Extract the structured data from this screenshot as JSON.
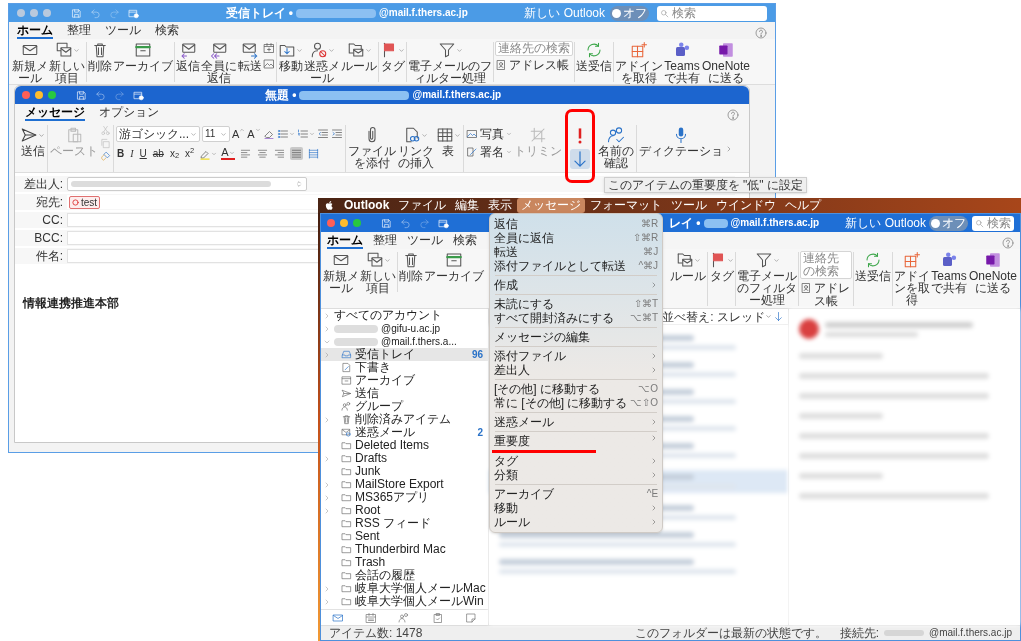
{
  "back_window": {
    "active": false,
    "title": {
      "prefix": "受信トレイ •",
      "suffix": "@mail.f.thers.ac.jp"
    },
    "new_outlook": {
      "label": "新しい Outlook",
      "toggle_text": "オフ",
      "on": false
    },
    "search": {
      "placeholder": "検索"
    },
    "tabs": [
      {
        "label": "ホーム",
        "selected": true
      },
      {
        "label": "整理",
        "selected": false
      },
      {
        "label": "ツール",
        "selected": false
      },
      {
        "label": "検索",
        "selected": false
      }
    ],
    "ribbon": [
      {
        "kind": "button",
        "label": "新規メール"
      },
      {
        "kind": "button",
        "label": "新しい項目",
        "dropdown": true
      },
      {
        "kind": "divider"
      },
      {
        "kind": "button",
        "label": "削除"
      },
      {
        "kind": "button",
        "label": "アーカイブ"
      },
      {
        "kind": "divider"
      },
      {
        "kind": "button",
        "label": "返信"
      },
      {
        "kind": "button",
        "label": "全員に返信"
      },
      {
        "kind": "button",
        "label": "転送"
      },
      {
        "kind": "stack"
      },
      {
        "kind": "divider"
      },
      {
        "kind": "button",
        "label": "移動",
        "dropdown": true
      },
      {
        "kind": "button",
        "label": "迷惑メール",
        "dropdown": true
      },
      {
        "kind": "button",
        "label": "ルール",
        "dropdown": true
      },
      {
        "kind": "divider"
      },
      {
        "kind": "button",
        "label": "タグ",
        "dropdown": true
      },
      {
        "kind": "divider"
      },
      {
        "kind": "button",
        "label": "電子メールのフィルター処理",
        "dropdown": true
      },
      {
        "kind": "divider"
      },
      {
        "kind": "search",
        "placeholder": "連絡先の検索",
        "label": "アドレス帳"
      },
      {
        "kind": "divider"
      },
      {
        "kind": "button",
        "label": "送受信"
      },
      {
        "kind": "divider"
      },
      {
        "kind": "button",
        "label": "アドインを取得"
      },
      {
        "kind": "button",
        "label": "Teamsで共有"
      },
      {
        "kind": "button",
        "label": "OneNoteに送る"
      }
    ]
  },
  "compose_window": {
    "active": true,
    "title": {
      "prefix": "無題 •",
      "suffix": "@mail.f.thers.ac.jp"
    },
    "tabs": [
      {
        "label": "メッセージ",
        "selected": true
      },
      {
        "label": "オプション",
        "selected": false
      }
    ],
    "send": {
      "label": "送信"
    },
    "paste": {
      "label": "ペースト",
      "disabled": true
    },
    "font": {
      "name": "游ゴシック...",
      "size": "11"
    },
    "grow_shrink": [
      {
        "kind": "grow",
        "label": "A"
      },
      {
        "kind": "shrink",
        "label": "A"
      }
    ],
    "format_buttons": [
      {
        "label": "B"
      },
      {
        "label": "I"
      },
      {
        "label": "U"
      },
      {
        "label": "ab"
      },
      {
        "label": "x$_{2}$"
      },
      {
        "label": "x$^{2}$"
      }
    ],
    "font_color": {
      "label": "A"
    },
    "align_buttons": [
      {
        "kind": "left",
        "selected": false
      },
      {
        "kind": "center",
        "selected": false
      },
      {
        "kind": "right",
        "selected": false
      },
      {
        "kind": "justify",
        "selected": true
      },
      {
        "kind": "distributed",
        "selected": false
      }
    ],
    "insert_buttons": [
      {
        "label": "ファイルを添付"
      },
      {
        "label": "リンクの挿入",
        "dropdown": true
      },
      {
        "label": "表",
        "dropdown": true
      }
    ],
    "small_buttons": [
      {
        "label": "写真"
      },
      {
        "label": "署名"
      }
    ],
    "crop": {
      "label": "トリミン",
      "disabled": true
    },
    "importance": {
      "annotated": true,
      "buttons": [
        {
          "kind": "high",
          "hovered": false
        },
        {
          "kind": "low",
          "hovered": true
        }
      ]
    },
    "tooltip": "このアイテムの重要度を \"低\" に設定",
    "check_names": {
      "label": "名前の確認"
    },
    "dictation": {
      "label": "ディクテーショ"
    },
    "fields": [
      {
        "kind": "select",
        "label": "差出人:"
      },
      {
        "kind": "recipients",
        "label": "宛先:",
        "chips": [
          "test"
        ]
      },
      {
        "kind": "text",
        "label": "CC:"
      },
      {
        "kind": "text",
        "label": "BCC:"
      },
      {
        "kind": "text",
        "label": "件名:"
      }
    ],
    "body": "情報連携推進本部"
  },
  "desktop": {
    "menu_bar": [
      {
        "kind": "app",
        "label": "Outlook",
        "selected": false
      },
      {
        "kind": "menu",
        "label": "ファイル",
        "selected": false
      },
      {
        "kind": "menu",
        "label": "編集",
        "selected": false
      },
      {
        "kind": "menu",
        "label": "表示",
        "selected": false
      },
      {
        "kind": "menu",
        "label": "メッセージ",
        "selected": true
      },
      {
        "kind": "menu",
        "label": "フォーマット",
        "selected": false
      },
      {
        "kind": "menu",
        "label": "ツール",
        "selected": false
      },
      {
        "kind": "menu",
        "label": "ウインドウ",
        "selected": false
      },
      {
        "kind": "menu",
        "label": "ヘルプ",
        "selected": false
      }
    ],
    "message_menu": [
      {
        "kind": "item",
        "label": "返信",
        "shortcut": "⌘R",
        "submenu": false,
        "underlined": false
      },
      {
        "kind": "item",
        "label": "全員に返信",
        "shortcut": "⇧⌘R",
        "submenu": false,
        "underlined": false
      },
      {
        "kind": "item",
        "label": "転送",
        "shortcut": "⌘J",
        "submenu": false,
        "underlined": false
      },
      {
        "kind": "item",
        "label": "添付ファイルとして転送",
        "shortcut": "^⌘J",
        "submenu": false,
        "underlined": false
      },
      {
        "kind": "separator"
      },
      {
        "kind": "item",
        "label": "作成",
        "submenu": true,
        "underlined": false
      },
      {
        "kind": "separator"
      },
      {
        "kind": "item",
        "label": "未読にする",
        "shortcut": "⇧⌘T",
        "submenu": false,
        "underlined": false
      },
      {
        "kind": "item",
        "label": "すべて開封済みにする",
        "shortcut": "⌥⌘T",
        "submenu": false,
        "underlined": false
      },
      {
        "kind": "separator"
      },
      {
        "kind": "item",
        "label": "メッセージの編集",
        "submenu": false,
        "underlined": false
      },
      {
        "kind": "separator"
      },
      {
        "kind": "item",
        "label": "添付ファイル",
        "submenu": true,
        "underlined": false
      },
      {
        "kind": "item",
        "label": "差出人",
        "submenu": true,
        "underlined": false
      },
      {
        "kind": "separator"
      },
      {
        "kind": "item",
        "label": "[その他] に移動する",
        "shortcut": "⌥O",
        "submenu": false,
        "underlined": false
      },
      {
        "kind": "item",
        "label": "常に [その他] に移動する",
        "shortcut": "⌥⇧O",
        "submenu": false,
        "underlined": false
      },
      {
        "kind": "separator"
      },
      {
        "kind": "item",
        "label": "迷惑メール",
        "submenu": true,
        "underlined": false
      },
      {
        "kind": "separator"
      },
      {
        "kind": "item",
        "label": "重要度",
        "submenu": true,
        "underlined": true
      },
      {
        "kind": "item",
        "label": "タグ",
        "submenu": true,
        "underlined": false
      },
      {
        "kind": "item",
        "label": "分類",
        "submenu": true,
        "underlined": false
      },
      {
        "kind": "separator"
      },
      {
        "kind": "item",
        "label": "アーカイブ",
        "shortcut": "^E",
        "submenu": false,
        "underlined": false
      },
      {
        "kind": "item",
        "label": "移動",
        "submenu": true,
        "underlined": false
      },
      {
        "kind": "item",
        "label": "ルール",
        "submenu": true,
        "underlined": false
      }
    ],
    "window": {
      "active": true,
      "title": {
        "prefix": "レイ •",
        "suffix": "@mail.f.thers.ac.jp"
      },
      "new_outlook": {
        "label": "新しい Outlook",
        "toggle_text": "オフ",
        "on": false
      },
      "search": {
        "placeholder": "検索"
      },
      "tabs": [
        {
          "label": "ホーム",
          "selected": true
        },
        {
          "label": "整理",
          "selected": false
        },
        {
          "label": "ツール",
          "selected": false
        },
        {
          "label": "検索",
          "selected": false
        }
      ],
      "ribbon_left": [
        {
          "kind": "button",
          "label": "新規メール"
        },
        {
          "kind": "button",
          "label": "新しい項目",
          "dropdown": true
        },
        {
          "kind": "divider"
        },
        {
          "kind": "button",
          "label": "削除"
        },
        {
          "kind": "button",
          "label": "アーカイブ"
        }
      ],
      "ribbon_right": [
        {
          "kind": "button",
          "label": "ルール",
          "dropdown": true
        },
        {
          "kind": "divider"
        },
        {
          "kind": "button",
          "label": "タグ",
          "dropdown": true
        },
        {
          "kind": "divider"
        },
        {
          "kind": "button",
          "label": "電子メールのフィルター処理",
          "dropdown": true
        },
        {
          "kind": "divider"
        },
        {
          "kind": "search",
          "placeholder": "連絡先の検索",
          "label": "アドレス帳"
        },
        {
          "kind": "divider"
        },
        {
          "kind": "button",
          "label": "送受信"
        },
        {
          "kind": "divider"
        },
        {
          "kind": "button",
          "label": "アドインを取得"
        },
        {
          "kind": "button",
          "label": "Teamsで共有"
        },
        {
          "kind": "button",
          "label": "OneNoteに送る"
        }
      ],
      "folders": [
        {
          "kind": "group",
          "label": "すべてのアカウント",
          "expanded": false,
          "selected": false
        },
        {
          "kind": "account",
          "label": "@gifu-u.ac.jp",
          "expanded": false,
          "selected": false
        },
        {
          "kind": "account",
          "label": "@mail.f.thers.a...",
          "expanded": true,
          "selected": false,
          "children": [
            {
              "kind": "group",
              "label": "受信トレイ",
              "count": "96",
              "expanded": false,
              "selected": true
            },
            {
              "kind": "folder",
              "label": "下書き",
              "selected": false
            },
            {
              "kind": "folder",
              "label": "アーカイブ",
              "selected": false
            },
            {
              "kind": "folder",
              "label": "送信",
              "selected": false
            },
            {
              "kind": "folder",
              "label": "グループ",
              "selected": false
            },
            {
              "kind": "group",
              "label": "削除済みアイテム",
              "expanded": false,
              "selected": false
            },
            {
              "kind": "folder",
              "label": "迷惑メール",
              "count": "2",
              "selected": false
            },
            {
              "kind": "folder",
              "label": "Deleted Items",
              "selected": false
            },
            {
              "kind": "group",
              "label": "Drafts",
              "expanded": false,
              "selected": false
            },
            {
              "kind": "folder",
              "label": "Junk",
              "selected": false
            },
            {
              "kind": "group",
              "label": "MailStore Export",
              "expanded": false,
              "selected": false
            },
            {
              "kind": "group",
              "label": "MS365アプリ",
              "expanded": false,
              "selected": false
            },
            {
              "kind": "group",
              "label": "Root",
              "expanded": false,
              "selected": false
            },
            {
              "kind": "folder",
              "label": "RSS フィード",
              "selected": false
            },
            {
              "kind": "folder",
              "label": "Sent",
              "selected": false
            },
            {
              "kind": "folder",
              "label": "Thunderbird Mac",
              "selected": false
            },
            {
              "kind": "folder",
              "label": "Trash",
              "selected": false
            },
            {
              "kind": "folder",
              "label": "会話の履歴",
              "selected": false
            },
            {
              "kind": "group",
              "label": "岐阜大学個人メールMac",
              "expanded": false,
              "selected": false
            },
            {
              "kind": "group",
              "label": "岐阜大学個人メールWin",
              "expanded": false,
              "selected": false
            }
          ]
        }
      ],
      "nav": [
        {
          "selected": true
        },
        {
          "selected": false
        },
        {
          "selected": false
        },
        {
          "selected": false
        },
        {
          "selected": false
        }
      ],
      "sort_label": "並べ替え: スレッド",
      "status": {
        "count": "アイテム数: 1478",
        "sync": "このフォルダーは最新の状態です。",
        "connected_prefix": "接続先:",
        "connected_suffix": "@mail.f.thers.ac.jp"
      }
    }
  }
}
